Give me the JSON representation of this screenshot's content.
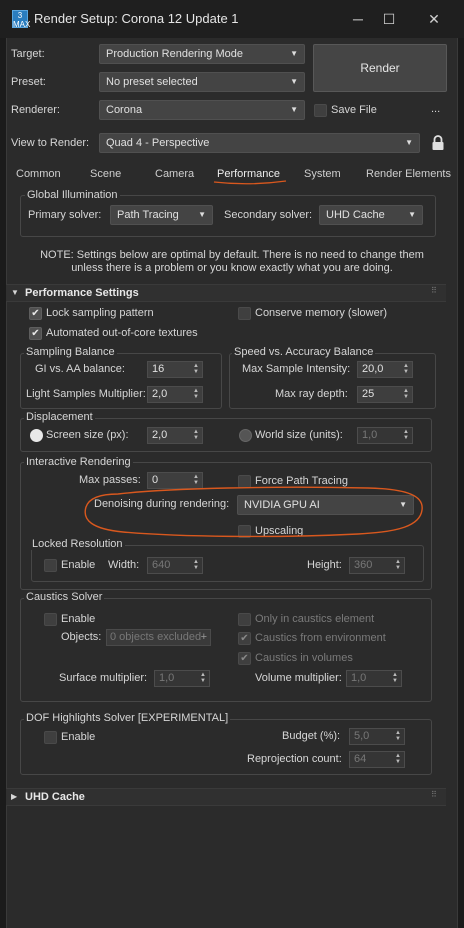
{
  "window": {
    "title": "Render Setup: Corona 12 Update 1",
    "app_icon_text": "3 MAX",
    "minimize_glyph": "─",
    "maximize_glyph": "☐",
    "close_glyph": "✕"
  },
  "top": {
    "target_label": "Target:",
    "target_value": "Production Rendering Mode",
    "preset_label": "Preset:",
    "preset_value": "No preset selected",
    "renderer_label": "Renderer:",
    "renderer_value": "Corona",
    "save_file_label": "Save File",
    "more_glyph": "...",
    "view_label": "View to Render:",
    "view_value": "Quad 4 - Perspective",
    "render_button": "Render",
    "lock_icon": "lock-icon"
  },
  "tabs": [
    "Common",
    "Scene",
    "Camera",
    "Performance",
    "System",
    "Render Elements"
  ],
  "active_tab": "Performance",
  "gi": {
    "title": "Global Illumination",
    "primary_label": "Primary solver:",
    "primary_value": "Path Tracing",
    "secondary_label": "Secondary solver:",
    "secondary_value": "UHD Cache",
    "note_line1": "NOTE: Settings below are optimal by default. There is no need to change them",
    "note_line2": "unless there is a problem or you know exactly what you are doing."
  },
  "perf": {
    "header": "Performance Settings",
    "expand_glyph": "▼",
    "lock_sampling": "Lock sampling pattern",
    "conserve_memory": "Conserve memory (slower)",
    "out_of_core": "Automated out-of-core textures",
    "check_glyph": "✔",
    "sampling_title": "Sampling Balance",
    "gi_aa_label": "GI vs. AA balance:",
    "gi_aa_value": "16",
    "light_mult_label": "Light Samples Multiplier:",
    "light_mult_value": "2,0",
    "speed_title": "Speed vs. Accuracy Balance",
    "max_intensity_label": "Max Sample Intensity:",
    "max_intensity_value": "20,0",
    "max_ray_label": "Max ray depth:",
    "max_ray_value": "25",
    "disp_title": "Displacement",
    "screen_size_label": "Screen size (px):",
    "screen_size_value": "2,0",
    "world_size_label": "World size (units):",
    "world_size_value": "1,0",
    "ir_title": "Interactive Rendering",
    "max_passes_label": "Max passes:",
    "max_passes_value": "0",
    "force_path_label": "Force Path Tracing",
    "denoise_label": "Denoising during rendering:",
    "denoise_value": "NVIDIA GPU AI",
    "upscaling_label": "Upscaling",
    "locked_res_title": "Locked Resolution",
    "enable_label": "Enable",
    "width_label": "Width:",
    "width_value": "640",
    "height_label": "Height:",
    "height_value": "360",
    "caustics_title": "Caustics Solver",
    "caustics_enable": "Enable",
    "only_caustics_label": "Only in caustics element",
    "objects_label": "Objects:",
    "objects_value": "0 objects excluded",
    "caustics_env_label": "Caustics from environment",
    "caustics_vol_label": "Caustics in volumes",
    "surface_mult_label": "Surface multiplier:",
    "surface_mult_value": "1,0",
    "volume_mult_label": "Volume multiplier:",
    "volume_mult_value": "1,0",
    "dof_title": "DOF Highlights Solver [EXPERIMENTAL]",
    "dof_enable": "Enable",
    "budget_label": "Budget (%):",
    "budget_value": "5,0",
    "reproj_label": "Reprojection count:",
    "reproj_value": "64"
  },
  "uhd": {
    "header": "UHD Cache",
    "expand_glyph": "▶"
  },
  "colors": {
    "annotation": "#d9581e",
    "tab_underline": "#d9581e"
  }
}
